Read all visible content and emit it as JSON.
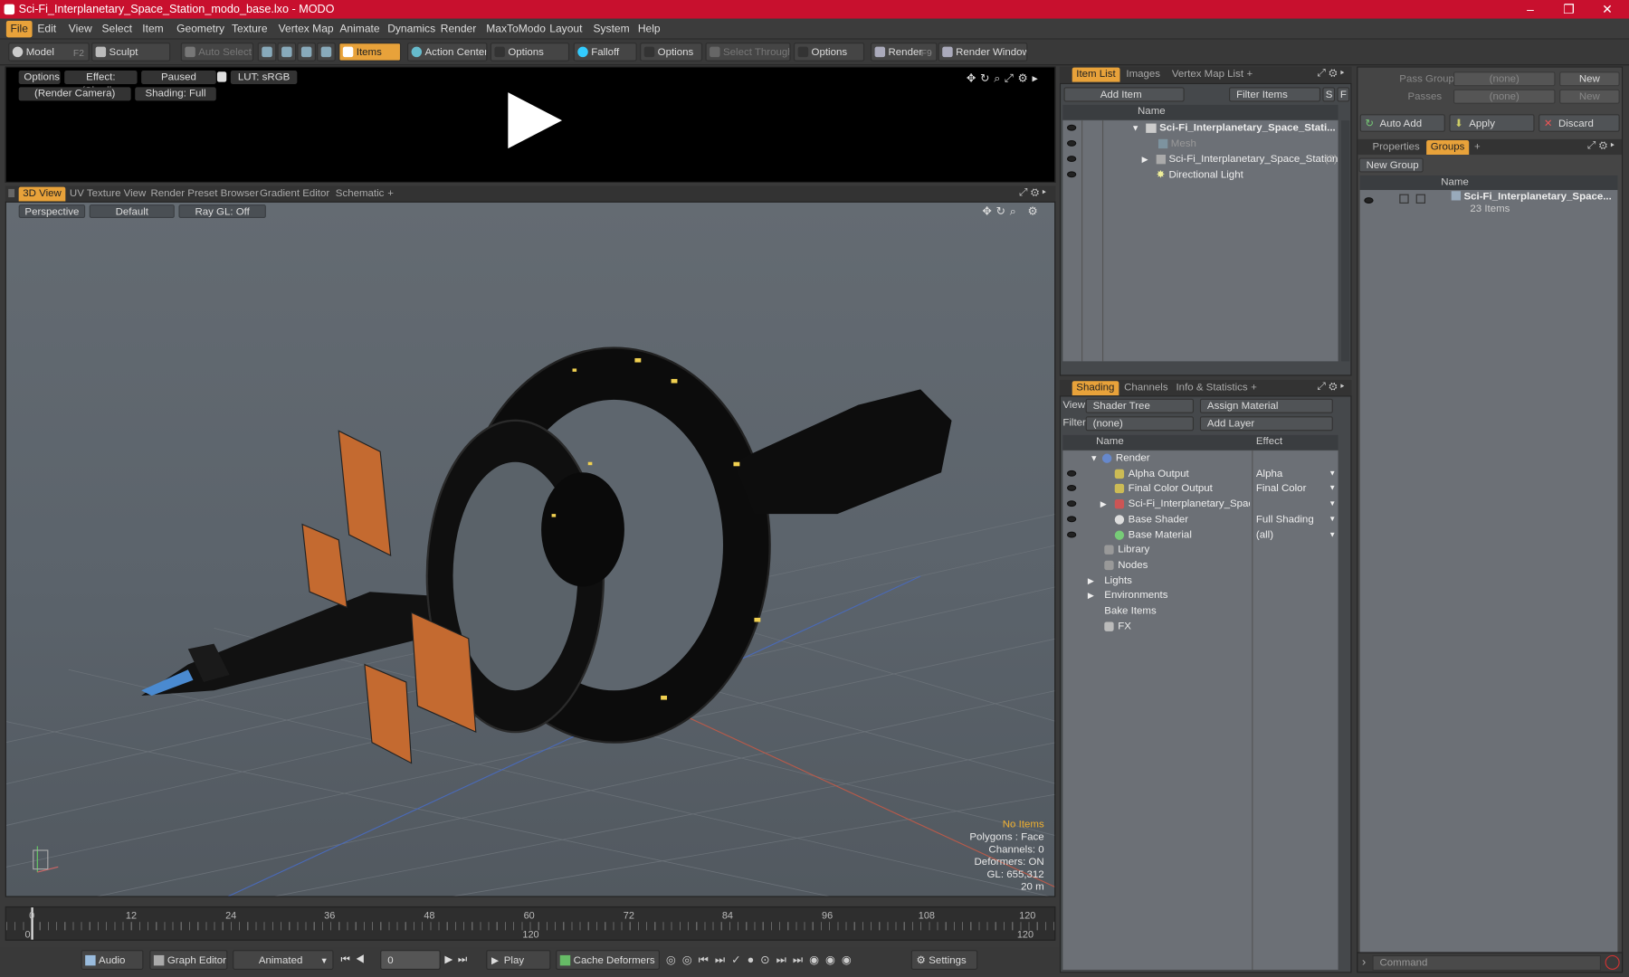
{
  "window": {
    "title": "Sci-Fi_Interplanetary_Space_Station_modo_base.lxo - MODO",
    "minimize": "–",
    "maximize": "❐",
    "close": "✕"
  },
  "menu": [
    "File",
    "Edit",
    "View",
    "Select",
    "Item",
    "Geometry",
    "Texture",
    "Vertex Map",
    "Animate",
    "Dynamics",
    "Render",
    "MaxToModo",
    "Layout",
    "System",
    "Help"
  ],
  "toolbar": {
    "model": "Model",
    "model_key": "F2",
    "sculpt": "Sculpt",
    "auto_select": "Auto Select",
    "items": "Items",
    "action_center": "Action Center",
    "options1": "Options",
    "falloff": "Falloff",
    "options2": "Options",
    "select_through": "Select Through",
    "options3": "Options",
    "render": "Render",
    "render_key": "F9",
    "render_window": "Render Window"
  },
  "preview": {
    "options": "Options",
    "effect": "Effect: (Shadi...",
    "paused": "Paused",
    "lut": "LUT: sRGB",
    "camera": "(Render Camera)",
    "shading": "Shading: Full"
  },
  "viewtabs": [
    "3D View",
    "UV Texture View",
    "Render Preset Browser",
    "Gradient Editor",
    "Schematic",
    "+"
  ],
  "viewport": {
    "perspective": "Perspective",
    "default": "Default",
    "raygl": "Ray GL: Off",
    "no_items": "No Items",
    "polygons": "Polygons : Face",
    "channels": "Channels: 0",
    "deformers": "Deformers: ON",
    "gl": "GL: 655,312",
    "scale": "20 m"
  },
  "timeline": {
    "ticks": [
      "0",
      "12",
      "24",
      "36",
      "48",
      "60",
      "72",
      "84",
      "96",
      "108",
      "120"
    ],
    "start": "0",
    "mid": "120",
    "end": "120"
  },
  "bottom": {
    "audio": "Audio",
    "graph_editor": "Graph Editor",
    "animated": "Animated",
    "frame": "0",
    "play": "Play",
    "cache": "Cache Deformers",
    "settings": "Settings"
  },
  "itemlist": {
    "tabs": [
      "Item List",
      "Images",
      "Vertex Map List",
      "+"
    ],
    "add_item": "Add Item",
    "filter": "Filter Items",
    "s": "S",
    "f": "F",
    "col_name": "Name",
    "rows": [
      {
        "label": "Sci-Fi_Interplanetary_Space_Stati...",
        "bold": true
      },
      {
        "label": "Mesh",
        "dim": true
      },
      {
        "label": "Sci-Fi_Interplanetary_Space_Station",
        "count": "(2)"
      },
      {
        "label": "Directional Light"
      }
    ]
  },
  "shading": {
    "tabs": [
      "Shading",
      "Channels",
      "Info & Statistics",
      "+"
    ],
    "view_label": "View",
    "view_value": "Shader Tree",
    "assign": "Assign Material",
    "filter_label": "Filter",
    "filter_value": "(none)",
    "add_layer": "Add Layer",
    "col_name": "Name",
    "col_effect": "Effect",
    "rows": [
      {
        "name": "Render",
        "effect": ""
      },
      {
        "name": "Alpha Output",
        "effect": "Alpha"
      },
      {
        "name": "Final Color Output",
        "effect": "Final Color"
      },
      {
        "name": "Sci-Fi_Interplanetary_Spac...",
        "effect": ""
      },
      {
        "name": "Base Shader",
        "effect": "Full Shading"
      },
      {
        "name": "Base Material",
        "effect": "(all)"
      },
      {
        "name": "Library",
        "effect": ""
      },
      {
        "name": "Nodes",
        "effect": ""
      },
      {
        "name": "Lights",
        "effect": ""
      },
      {
        "name": "Environments",
        "effect": ""
      },
      {
        "name": "Bake Items",
        "effect": ""
      },
      {
        "name": "FX",
        "effect": ""
      }
    ]
  },
  "rightpanel": {
    "pass_groups": "Pass Groups",
    "passes": "Passes",
    "none": "(none)",
    "new": "New",
    "auto_add": "Auto Add",
    "apply": "Apply",
    "discard": "Discard",
    "tabs": [
      "Properties",
      "Groups",
      "+"
    ],
    "new_group": "New Group",
    "col_name": "Name",
    "group_name": "Sci-Fi_Interplanetary_Space...",
    "group_items": "23 Items",
    "command": "Command"
  }
}
